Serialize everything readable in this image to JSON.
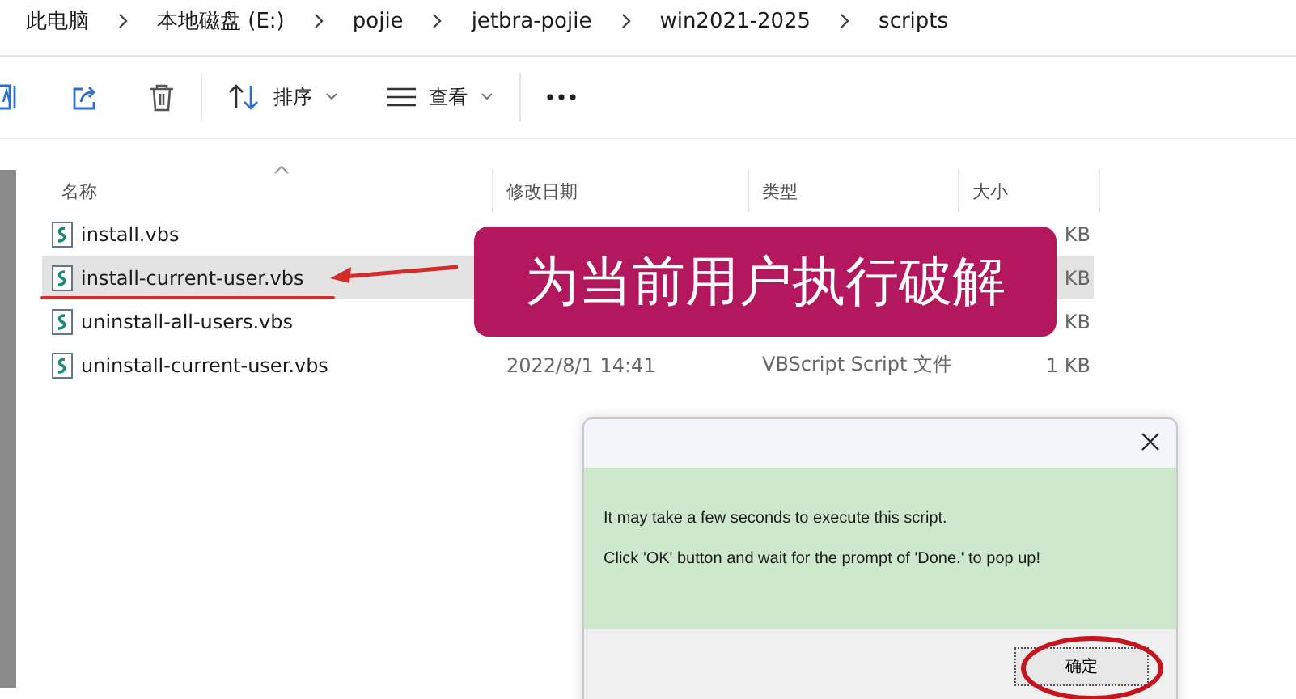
{
  "breadcrumb": [
    "此电脑",
    "本地磁盘 (E:)",
    "pojie",
    "jetbra-pojie",
    "win2021-2025",
    "scripts"
  ],
  "toolbar": {
    "sort_label": "排序",
    "view_label": "查看"
  },
  "columns": [
    "名称",
    "修改日期",
    "类型",
    "大小"
  ],
  "files": [
    {
      "name": "install.vbs",
      "size": "KB",
      "selected": false
    },
    {
      "name": "install-current-user.vbs",
      "size": "KB",
      "selected": true
    },
    {
      "name": "uninstall-all-users.vbs",
      "size": "KB",
      "selected": false
    },
    {
      "name": "uninstall-current-user.vbs",
      "date": "2022/8/1 14:41",
      "type": "VBScript Script 文件",
      "size": "1 KB",
      "selected": false
    }
  ],
  "callout": "为当前用户执行破解",
  "dialog": {
    "lines": [
      "It may take a few seconds to execute this script.",
      "Click 'OK' button and wait for the prompt of 'Done.' to pop up!"
    ],
    "button": "确定"
  }
}
